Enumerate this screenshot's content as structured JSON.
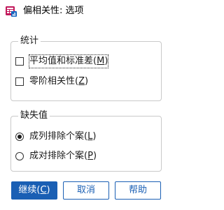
{
  "window": {
    "title": "偏相关性: 选项",
    "icon": "spss-dialog-icon",
    "accent_color": "#1a5fb4"
  },
  "statistics_group": {
    "legend": "统计",
    "items": [
      {
        "label": "平均值和标准差",
        "mnemonic": "M",
        "checked": false,
        "focused": true
      },
      {
        "label": "零阶相关性",
        "mnemonic": "Z",
        "checked": false,
        "focused": false
      }
    ]
  },
  "missing_group": {
    "legend": "缺失值",
    "options": [
      {
        "label": "成列排除个案",
        "mnemonic": "L",
        "selected": true
      },
      {
        "label": "成对排除个案",
        "mnemonic": "P",
        "selected": false
      }
    ]
  },
  "buttons": {
    "continue": {
      "label": "继续",
      "mnemonic": "C"
    },
    "cancel": {
      "label": "取消"
    },
    "help": {
      "label": "帮助"
    }
  }
}
